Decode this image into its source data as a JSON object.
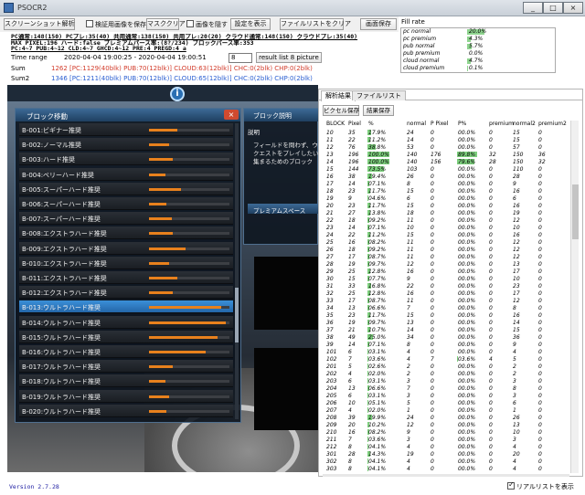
{
  "window": {
    "title": "PSOCR2",
    "min": "_",
    "max": "□",
    "close": "×"
  },
  "toolbar": {
    "screenshot_btn": "スクリーンショット解析",
    "save_verify_check": "検証用画像を保存",
    "mask_btn": "マスククリア",
    "hide_image_check": "画像を隠す",
    "show_settings_btn": "設定を表示",
    "clear_filelist_btn": "ファイルリストをクリア",
    "save_image_btn": "画面保存"
  },
  "status_lines": [
    "PC通常:148(150) PCプレ:35(40) 共用通常:138(150) 共用プレ:20(20) クラウド通常:148(150) クラウドプレ:35(40)",
    "MAX PIXEL:196 ハード:false プレミアムパース率:(8?/234) ブロックパース率:353",
    "PC:4~7 PUB:4~12 CLD:4~7 GHCD:4~12 PRE:4 PREGD:4 a"
  ],
  "time": {
    "label": "Time range",
    "value": "2020-04-04 19:00:25 - 2020-04-04 19:00:51",
    "input": "8",
    "result_btn": "result list 8 picture"
  },
  "sums": [
    {
      "label": "Sum",
      "value": "1262 [PC:1129(40blk) PUB:70(12blk)] CLOUD:63(12blk)] CHC:0(2blk) CHP:0(2blk)"
    },
    {
      "label": "Sum2",
      "value": "1346 [PC:1211(40blk) PUB:70(12blk)] CLOUD:65(12blk)] CHC:0(2blk) CHP:0(2blk)"
    }
  ],
  "fill_rate": {
    "title": "Fill rate",
    "rows": [
      {
        "name": "pc normal",
        "value": "20.0%",
        "pct": 20.0
      },
      {
        "name": "pc premium",
        "value": "4.3%",
        "pct": 4.3
      },
      {
        "name": "pub normal",
        "value": "5.7%",
        "pct": 5.7
      },
      {
        "name": "pub premium",
        "value": "0.0%",
        "pct": 0.0
      },
      {
        "name": "cloud normal",
        "value": "4.7%",
        "pct": 4.7
      },
      {
        "name": "cloud premium",
        "value": "0.1%",
        "pct": 0.1
      }
    ]
  },
  "game": {
    "badge": "i",
    "block_panel_title": "ブロック移動",
    "block_close": "×",
    "blocks": [
      {
        "name": "B-001:ビギナー推奨",
        "fill": 0.35
      },
      {
        "name": "B-002:ノーマル推奨",
        "fill": 0.25
      },
      {
        "name": "B-003:ハード推奨",
        "fill": 0.3
      },
      {
        "name": "B-004:ベリーハード推奨",
        "fill": 0.2
      },
      {
        "name": "B-005:スーパーハード推奨",
        "fill": 0.4
      },
      {
        "name": "B-006:スーパーハード推奨",
        "fill": 0.22
      },
      {
        "name": "B-007:スーパーハード推奨",
        "fill": 0.28
      },
      {
        "name": "B-008:エクストラハード推奨",
        "fill": 0.3
      },
      {
        "name": "B-009:エクストラハード推奨",
        "fill": 0.45
      },
      {
        "name": "B-010:エクストラハード推奨",
        "fill": 0.25
      },
      {
        "name": "B-011:エクストラハード推奨",
        "fill": 0.35
      },
      {
        "name": "B-012:エクストラハード推奨",
        "fill": 0.3
      },
      {
        "name": "B-013:ウルトラハード推奨",
        "fill": 0.9
      },
      {
        "name": "B-014:ウルトラハード推奨",
        "fill": 0.95
      },
      {
        "name": "B-015:ウルトラハード推奨",
        "fill": 0.85
      },
      {
        "name": "B-016:ウルトラハード推奨",
        "fill": 0.7
      },
      {
        "name": "B-017:ウルトラハード推奨",
        "fill": 0.3
      },
      {
        "name": "B-018:ウルトラハード推奨",
        "fill": 0.2
      },
      {
        "name": "B-019:ウルトラハード推奨",
        "fill": 0.25
      },
      {
        "name": "B-020:ウルトラハード推奨",
        "fill": 0.22
      }
    ],
    "selected_index": 12,
    "desc_title": "ブロック説明",
    "desc_sub": "説明",
    "desc_text": "フィールドを問わず、ウ\nクエストをプレイしたい\n集まるためのブロック",
    "premium_header": "プレミアムスペース"
  },
  "analysis": {
    "tabs": [
      "解析結果",
      "ファイルリスト"
    ],
    "buttons": [
      "ピクセル保存",
      "結果保存"
    ],
    "headers": [
      "BLOCK",
      "Pixel",
      "%",
      "normal",
      "P Pixel",
      "P%",
      "premium",
      "normal2",
      "premium2"
    ],
    "rows": [
      [
        "10",
        "35",
        "17.9%",
        "24",
        "0",
        "00.0%",
        "0",
        "15",
        "0"
      ],
      [
        "11",
        "22",
        "11.2%",
        "14",
        "0",
        "00.0%",
        "0",
        "15",
        "0"
      ],
      [
        "12",
        "76",
        "38.8%",
        "53",
        "0",
        "00.0%",
        "0",
        "57",
        "0"
      ],
      [
        "13",
        "196",
        "100.0%",
        "140",
        "176",
        "89.8%",
        "32",
        "150",
        "36"
      ],
      [
        "14",
        "196",
        "100.0%",
        "140",
        "156",
        "79.6%",
        "28",
        "150",
        "32"
      ],
      [
        "15",
        "144",
        "73.5%",
        "103",
        "0",
        "00.0%",
        "0",
        "110",
        "0"
      ],
      [
        "16",
        "38",
        "19.4%",
        "26",
        "0",
        "00.0%",
        "0",
        "28",
        "0"
      ],
      [
        "17",
        "14",
        "07.1%",
        "8",
        "0",
        "00.0%",
        "0",
        "9",
        "0"
      ],
      [
        "18",
        "23",
        "11.7%",
        "15",
        "0",
        "00.0%",
        "0",
        "16",
        "0"
      ],
      [
        "19",
        "9",
        "04.6%",
        "6",
        "0",
        "00.0%",
        "0",
        "6",
        "0"
      ],
      [
        "20",
        "23",
        "11.7%",
        "15",
        "0",
        "00.0%",
        "0",
        "16",
        "0"
      ],
      [
        "21",
        "27",
        "13.8%",
        "18",
        "0",
        "00.0%",
        "0",
        "19",
        "0"
      ],
      [
        "22",
        "18",
        "09.2%",
        "11",
        "0",
        "00.0%",
        "0",
        "12",
        "0"
      ],
      [
        "23",
        "14",
        "07.1%",
        "10",
        "0",
        "00.0%",
        "0",
        "10",
        "0"
      ],
      [
        "24",
        "22",
        "11.2%",
        "15",
        "0",
        "00.0%",
        "0",
        "16",
        "0"
      ],
      [
        "25",
        "16",
        "08.2%",
        "11",
        "0",
        "00.0%",
        "0",
        "12",
        "0"
      ],
      [
        "26",
        "18",
        "09.2%",
        "11",
        "0",
        "00.0%",
        "0",
        "12",
        "0"
      ],
      [
        "27",
        "17",
        "08.7%",
        "11",
        "0",
        "00.0%",
        "0",
        "12",
        "0"
      ],
      [
        "28",
        "19",
        "09.7%",
        "12",
        "0",
        "00.0%",
        "0",
        "13",
        "0"
      ],
      [
        "29",
        "25",
        "12.8%",
        "16",
        "0",
        "00.0%",
        "0",
        "17",
        "0"
      ],
      [
        "30",
        "15",
        "07.7%",
        "9",
        "0",
        "00.0%",
        "0",
        "10",
        "0"
      ],
      [
        "31",
        "33",
        "16.8%",
        "22",
        "0",
        "00.0%",
        "0",
        "23",
        "0"
      ],
      [
        "32",
        "25",
        "12.8%",
        "16",
        "0",
        "00.0%",
        "0",
        "17",
        "0"
      ],
      [
        "33",
        "17",
        "08.7%",
        "11",
        "0",
        "00.0%",
        "0",
        "12",
        "0"
      ],
      [
        "34",
        "13",
        "06.6%",
        "7",
        "0",
        "00.0%",
        "0",
        "8",
        "0"
      ],
      [
        "35",
        "23",
        "11.7%",
        "15",
        "0",
        "00.0%",
        "0",
        "16",
        "0"
      ],
      [
        "36",
        "19",
        "09.7%",
        "13",
        "0",
        "00.0%",
        "0",
        "14",
        "0"
      ],
      [
        "37",
        "21",
        "10.7%",
        "14",
        "0",
        "00.0%",
        "0",
        "15",
        "0"
      ],
      [
        "38",
        "49",
        "25.0%",
        "34",
        "0",
        "00.0%",
        "0",
        "36",
        "0"
      ],
      [
        "39",
        "14",
        "07.1%",
        "8",
        "0",
        "00.0%",
        "0",
        "9",
        "0"
      ],
      [
        "101",
        "6",
        "03.1%",
        "4",
        "0",
        "00.0%",
        "0",
        "4",
        "0"
      ],
      [
        "102",
        "7",
        "03.6%",
        "4",
        "7",
        "03.6%",
        "4",
        "5",
        "0"
      ],
      [
        "201",
        "5",
        "02.6%",
        "2",
        "0",
        "00.0%",
        "0",
        "2",
        "0"
      ],
      [
        "202",
        "4",
        "02.0%",
        "2",
        "0",
        "00.0%",
        "0",
        "2",
        "0"
      ],
      [
        "203",
        "6",
        "03.1%",
        "3",
        "0",
        "00.0%",
        "0",
        "3",
        "0"
      ],
      [
        "204",
        "13",
        "06.6%",
        "7",
        "0",
        "00.0%",
        "0",
        "8",
        "0"
      ],
      [
        "205",
        "6",
        "03.1%",
        "3",
        "0",
        "00.0%",
        "0",
        "3",
        "0"
      ],
      [
        "206",
        "10",
        "05.1%",
        "5",
        "0",
        "00.0%",
        "0",
        "6",
        "0"
      ],
      [
        "207",
        "4",
        "02.0%",
        "1",
        "0",
        "00.0%",
        "0",
        "1",
        "0"
      ],
      [
        "208",
        "39",
        "19.9%",
        "24",
        "0",
        "00.0%",
        "0",
        "26",
        "0"
      ],
      [
        "209",
        "20",
        "10.2%",
        "12",
        "0",
        "00.0%",
        "0",
        "13",
        "0"
      ],
      [
        "210",
        "16",
        "08.2%",
        "9",
        "0",
        "00.0%",
        "0",
        "10",
        "0"
      ],
      [
        "211",
        "7",
        "03.6%",
        "3",
        "0",
        "00.0%",
        "0",
        "3",
        "0"
      ],
      [
        "212",
        "8",
        "04.1%",
        "4",
        "0",
        "00.0%",
        "0",
        "4",
        "0"
      ],
      [
        "301",
        "28",
        "14.3%",
        "19",
        "0",
        "00.0%",
        "0",
        "20",
        "0"
      ],
      [
        "302",
        "8",
        "04.1%",
        "4",
        "0",
        "00.0%",
        "0",
        "4",
        "0"
      ],
      [
        "303",
        "8",
        "04.1%",
        "4",
        "0",
        "00.0%",
        "0",
        "4",
        "0"
      ]
    ]
  },
  "footer": {
    "version": "Version 2.7.28",
    "realtime_label": "リアルリストを表示"
  }
}
